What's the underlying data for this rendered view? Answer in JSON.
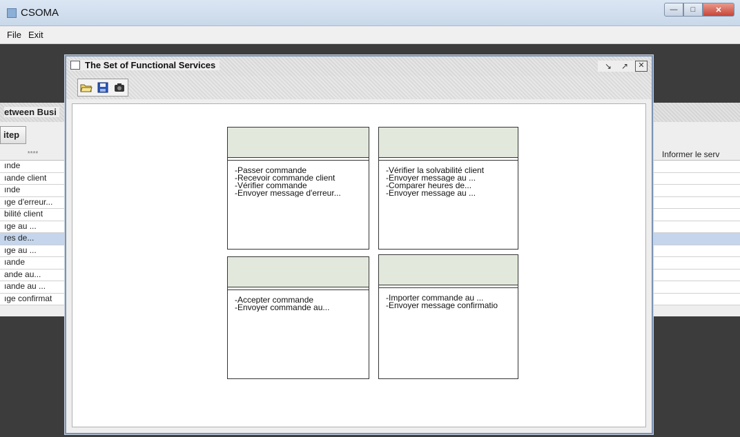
{
  "app": {
    "title": "CSOMA"
  },
  "menubar": {
    "items": [
      "File",
      "Exit"
    ]
  },
  "background_frame": {
    "title": "etween Busi",
    "step_button": "itep",
    "table_header": "****",
    "rows": [
      "ınde",
      "ıande client",
      "ınde",
      "ıge d'erreur...",
      "bilité client",
      "ıge au ...",
      "res de...",
      "ıge au ...",
      "ıande",
      "ande au...",
      "ıande au ...",
      "ıge confirmat"
    ],
    "selected_row": 6,
    "right_header": "Informer le serv"
  },
  "internal_frame": {
    "title": "The Set of Functional Services",
    "toolbar": [
      "open-folder-icon",
      "save-icon",
      "camera-icon"
    ]
  },
  "service_boxes": [
    {
      "items": [
        "-Passer commande",
        "-Recevoir commande client",
        "-Vérifier commande",
        "-Envoyer message d'erreur..."
      ]
    },
    {
      "items": [
        "-Vérifier la solvabilité client",
        "-Envoyer message au ...",
        "-Comparer heures de...",
        "-Envoyer message au ..."
      ]
    },
    {
      "items": [
        "-Accepter commande",
        "-Envoyer commande au..."
      ]
    },
    {
      "items": [
        "-Importer commande au ...",
        "-Envoyer message confirmatio"
      ]
    }
  ],
  "colors": {
    "box_header": "#e2e9dc",
    "selection": "#c4d5ec",
    "frame_border": "#7b93b3"
  }
}
